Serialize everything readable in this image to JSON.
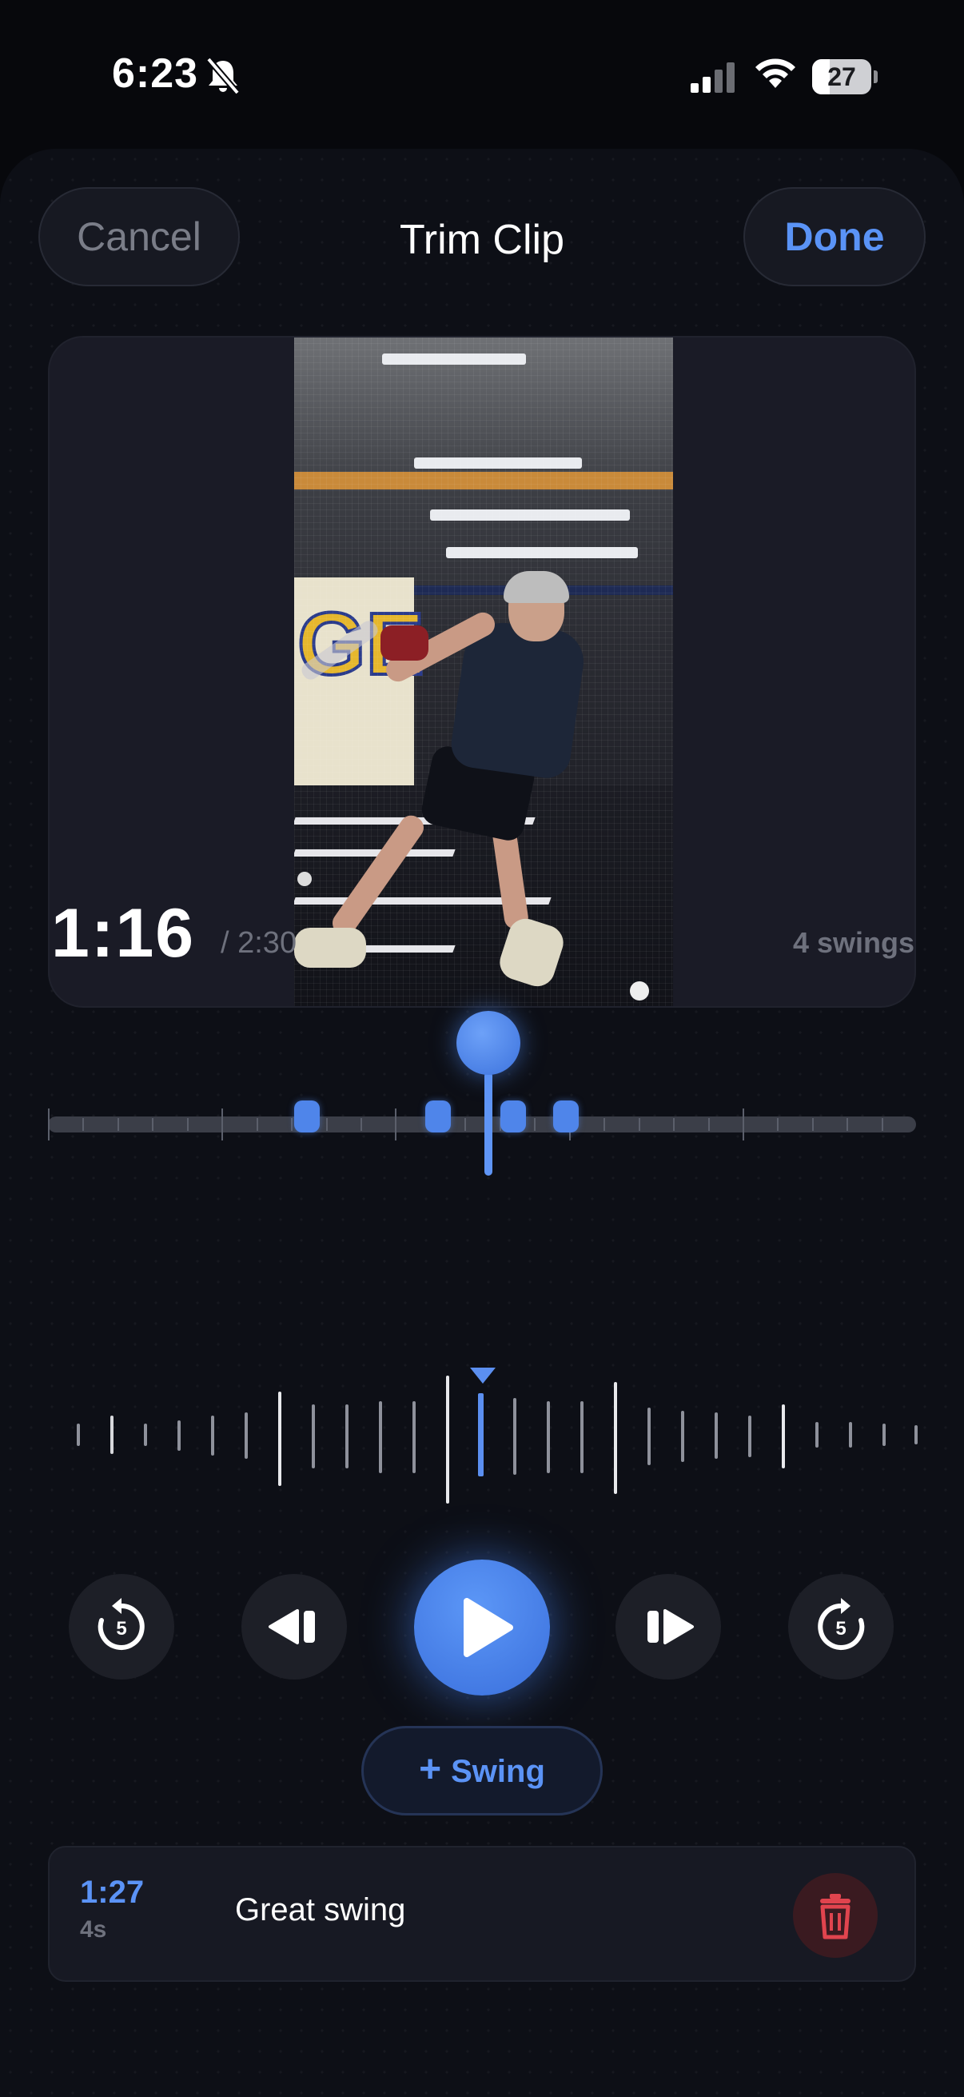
{
  "status_bar": {
    "time": "6:23",
    "battery": "27"
  },
  "header": {
    "cancel_label": "Cancel",
    "title": "Trim Clip",
    "done_label": "Done"
  },
  "playback": {
    "current_time": "1:16",
    "total_time": "/ 2:30",
    "swing_count": "4 swings"
  },
  "colors": {
    "accent": "#5b93f6",
    "background": "#0d0f16",
    "delete_red": "#e0444e"
  },
  "controls": {
    "rewind_5_icon": "rewind-5-icon",
    "prev_icon": "step-back-icon",
    "play_icon": "play-icon",
    "next_icon": "step-forward-icon",
    "forward_5_icon": "forward-5-icon",
    "skip_seconds": "5"
  },
  "add_swing_label": "Swing",
  "swings": [
    {
      "time": "1:27",
      "duration": "4s",
      "label": "Great swing"
    }
  ]
}
